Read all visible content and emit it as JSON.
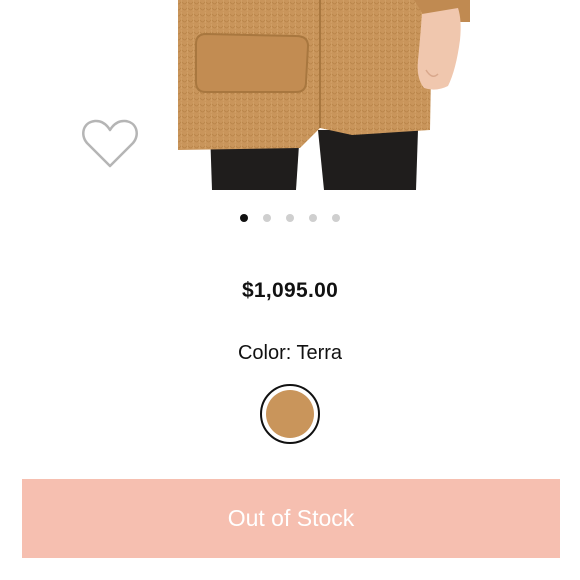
{
  "product": {
    "price": "$1,095.00",
    "color_label": "Color: Terra",
    "swatch_color": "#c9955b"
  },
  "gallery": {
    "slide_count": 5,
    "active_slide": 1
  },
  "wishlist": {
    "icon": "heart-outline-icon"
  },
  "actions": {
    "stock_button_label": "Out of Stock",
    "stock_button_color": "#f6bfb0"
  }
}
